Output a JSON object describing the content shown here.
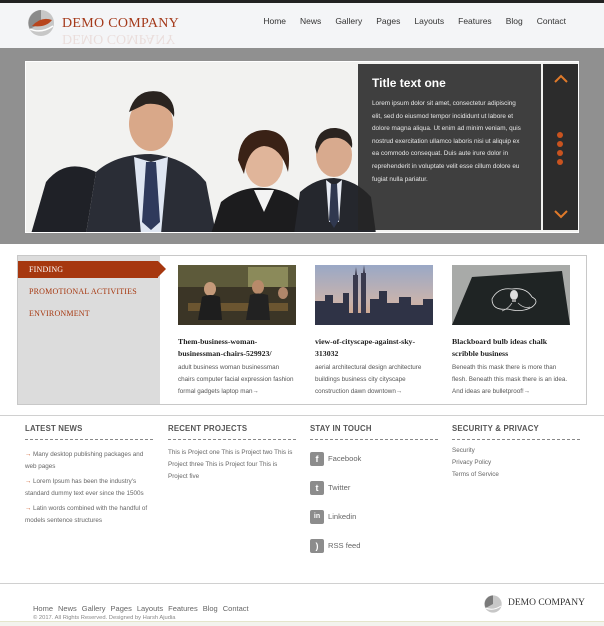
{
  "header": {
    "logo_text": "DEMO COMPANY",
    "nav": [
      "Home",
      "News",
      "Gallery",
      "Pages",
      "Layouts",
      "Features",
      "Blog",
      "Contact"
    ]
  },
  "slider": {
    "caption_title": "Title text one",
    "caption_text": "Lorem ipsum dolor sit amet, consectetur adipiscing elit, sed do eiusmod tempor incididunt ut labore et dolore magna aliqua. Ut enim ad minim veniam, quis nostrud exercitation ullamco laboris nisi ut aliquip ex ea commodo consequat. Duis aute irure dolor in reprehenderit in voluptate velit esse cillum dolore eu fugiat nulla pariatur.",
    "up_icon": "chevron-up-icon",
    "down_icon": "chevron-down-icon",
    "dots": 4
  },
  "sidebar": {
    "items": [
      "FINDING",
      "PROMOTIONAL ACTIVITIES",
      "ENVIRONMENT"
    ]
  },
  "cards": [
    {
      "title": "Them-business-woman-businessman-chairs-529923/",
      "text": "adult business woman businessman chairs computer facial expression fashion formal gadgets laptop man→"
    },
    {
      "title": "view-of-cityscape-against-sky-313032",
      "text": "aerial architectural design architecture buildings business city cityscape construction dawn downtown→"
    },
    {
      "title": "Blackboard bulb ideas chalk scribble business",
      "text": "Beneath this mask there is more than flesh. Beneath this mask there is an idea. And ideas are bulletproof!→"
    }
  ],
  "footer": {
    "latest_news": {
      "heading": "LATEST NEWS",
      "items": [
        "Many desktop publishing packages and web pages",
        "Lorem Ipsum has been the industry's standard dummy text ever since the 1500s",
        "Latin words combined with the handful of models sentence structures"
      ]
    },
    "recent_projects": {
      "heading": "RECENT PROJECTS",
      "text": "This is Project one This is  Project two This is  Project three This is  Project four This is  Project five"
    },
    "stay_in_touch": {
      "heading": "STAY IN TOUCH",
      "links": [
        {
          "icon": "facebook-icon",
          "glyph": "f",
          "label": "Facebook"
        },
        {
          "icon": "twitter-icon",
          "glyph": "t",
          "label": "Twitter"
        },
        {
          "icon": "linkedin-icon",
          "glyph": "in",
          "label": "Linkedin"
        },
        {
          "icon": "rss-icon",
          "glyph": ")",
          "label": "RSS feed"
        }
      ]
    },
    "security": {
      "heading": "SECURITY & PRIVACY",
      "links": [
        "Security",
        "Privacy Policy",
        "Terms of Service"
      ]
    }
  },
  "bottom": {
    "nav": [
      "Home",
      "News",
      "Gallery",
      "Pages",
      "Layouts",
      "Features",
      "Blog",
      "Contact"
    ],
    "copyright": "© 2017. All Rights Reserved. Designed by Harsh Ajudia",
    "logo_text": "DEMO COMPANY"
  },
  "colors": {
    "accent": "#a6370f",
    "arrow": "#e07a2a",
    "band": "#909090"
  }
}
